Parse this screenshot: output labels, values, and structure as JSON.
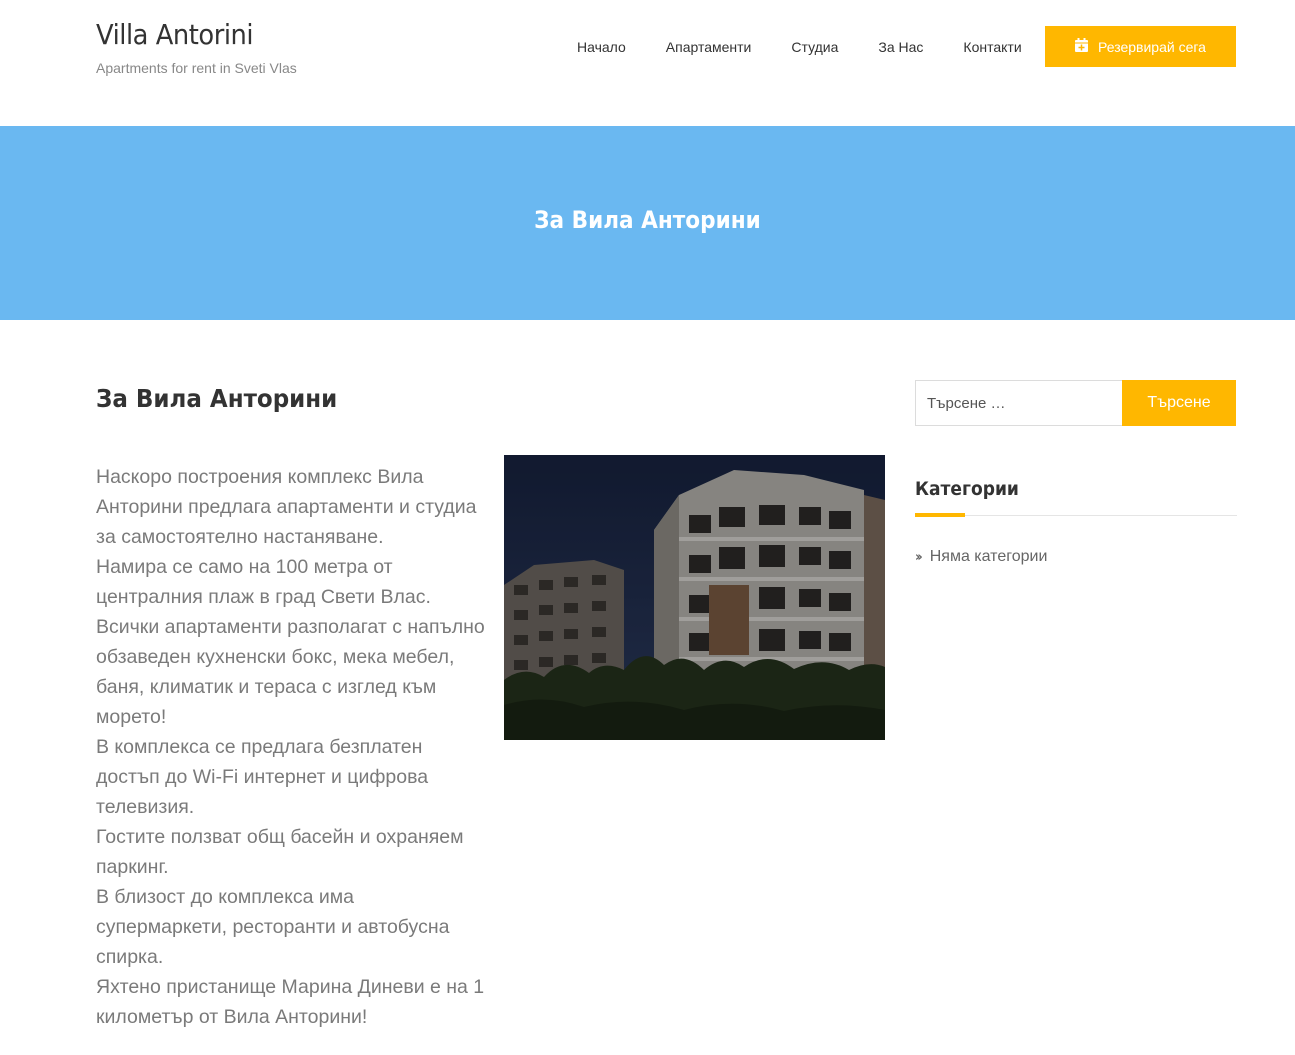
{
  "site": {
    "title": "Villa Antorini",
    "tagline": "Apartments for rent in Sveti Vlas"
  },
  "nav": {
    "items": [
      "Начало",
      "Апартаменти",
      "Студиа",
      "За Нас",
      "Контакти"
    ],
    "book_label": "Резервирай сега"
  },
  "banner": {
    "title": "За Вила Анторини"
  },
  "post": {
    "title": "За Вила Анторини",
    "lines": [
      "Наскоро построения комплекс Вила Анторини предлага апартаменти и студиа за самостоятелно настаняване.",
      "Намира се само на 100 метра от централния плаж в град Свети Влас.",
      "Всички апартаменти разполагат с напълно обзаведен кухненски бокс, мека мебел, баня, климатик и тераса с изглед към морето!",
      "В комплекса се предлага безплатен достъп до Wi-Fi интернет и цифрова телевизия.",
      "Гостите ползват общ басейн и охраняем паркинг.",
      "В близост до комплекса има супермаркети, ресторанти и автобусна спирка.",
      "Яхтено пристанище Марина Диневи е на 1 километър от Вила Анторини!"
    ]
  },
  "sidebar": {
    "search_placeholder": "Търсене …",
    "search_button": "Търсене",
    "categories_title": "Категории",
    "no_categories": "Няма категории"
  },
  "colors": {
    "accent": "#ffb700",
    "banner": "#6ab8f1"
  }
}
